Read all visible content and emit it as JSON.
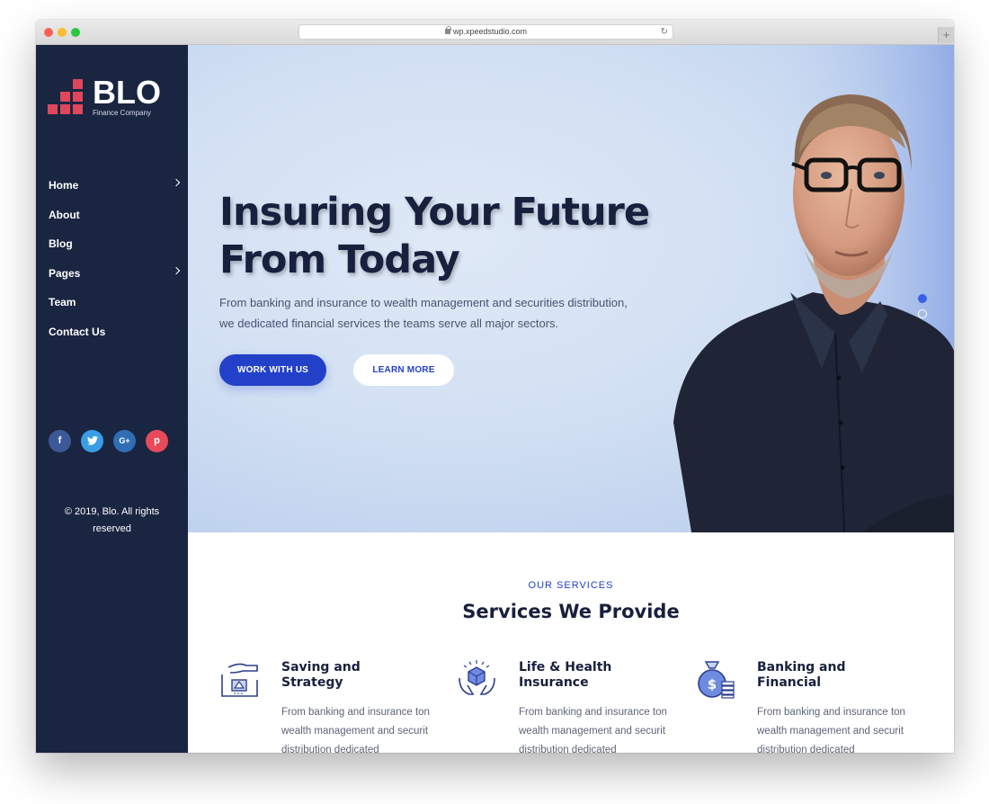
{
  "browser": {
    "url": "wp.xpeedstudio.com"
  },
  "brand": {
    "name": "BLO",
    "tagline": "Finance Company",
    "accent": "#e0475c"
  },
  "nav": {
    "items": [
      {
        "label": "Home",
        "has_submenu": true
      },
      {
        "label": "About",
        "has_submenu": false
      },
      {
        "label": "Blog",
        "has_submenu": false
      },
      {
        "label": "Pages",
        "has_submenu": true
      },
      {
        "label": "Team",
        "has_submenu": false
      },
      {
        "label": "Contact Us",
        "has_submenu": false
      }
    ]
  },
  "socials": [
    {
      "icon": "facebook-icon",
      "glyph": "f",
      "color": "#3b5998"
    },
    {
      "icon": "twitter-icon",
      "glyph": "t",
      "color": "#3a9ee7"
    },
    {
      "icon": "google-plus-icon",
      "glyph": "G+",
      "color": "#2f6db4"
    },
    {
      "icon": "pinterest-icon",
      "glyph": "p",
      "color": "#e84a5a"
    }
  ],
  "footer": {
    "copyright_line1": "© 2019, Blo. All rights",
    "copyright_line2": "reserved"
  },
  "hero": {
    "title_line1": "Insuring Your Future",
    "title_line2": "From Today",
    "text_line1": "From banking and insurance to wealth management and securities distribution,",
    "text_line2": "we dedicated financial services the teams serve all major sectors.",
    "primary_button": "WORK WITH US",
    "secondary_button": "LEARN MORE",
    "primary_color": "#2340c8"
  },
  "services": {
    "eyebrow": "OUR SERVICES",
    "title": "Services We Provide",
    "items": [
      {
        "icon": "savings-hand-icon",
        "title_line1": "Saving and",
        "title_line2": "Strategy",
        "text": "From banking and insurance ton wealth management and securit distribution dedicated"
      },
      {
        "icon": "health-insurance-icon",
        "title_line1": "Life & Health",
        "title_line2": "Insurance",
        "text": "From banking and insurance ton wealth management and securit distribution dedicated"
      },
      {
        "icon": "money-bag-icon",
        "title_line1": "Banking and",
        "title_line2": "Financial",
        "text": "From banking and insurance ton wealth management and securit distribution dedicated"
      }
    ]
  }
}
